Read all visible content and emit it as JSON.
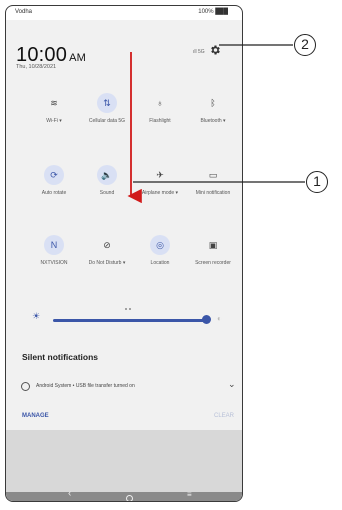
{
  "status_bar": {
    "carrier": "Vodha",
    "battery": "100% ███"
  },
  "header": {
    "time": "10:00",
    "ampm": "AM",
    "date": "Thu, 10/28/2021",
    "signal": "ıll 5G"
  },
  "tiles": [
    {
      "label": "Wi-Fi ▾",
      "icon": "wifi-off-icon",
      "glyph": "≋",
      "active": false
    },
    {
      "label": "Cellular data 5G",
      "icon": "cellular-data-icon",
      "glyph": "⇅",
      "active": true
    },
    {
      "label": "Flashlight",
      "icon": "flashlight-icon",
      "glyph": "♁",
      "active": false
    },
    {
      "label": "Bluetooth ▾",
      "icon": "bluetooth-icon",
      "glyph": "ᛒ",
      "active": false
    },
    {
      "label": "Auto rotate",
      "icon": "auto-rotate-icon",
      "glyph": "⟳",
      "active": true
    },
    {
      "label": "Sound",
      "icon": "sound-icon",
      "glyph": "🔈",
      "active": true
    },
    {
      "label": "Airplane mode ▾",
      "icon": "airplane-icon",
      "glyph": "✈",
      "active": false
    },
    {
      "label": "Mini notification",
      "icon": "mini-notification-icon",
      "glyph": "▭",
      "active": false
    },
    {
      "label": "NXTVISION",
      "icon": "nxtvision-icon",
      "glyph": "N",
      "active": true
    },
    {
      "label": "Do Not Disturb ▾",
      "icon": "do-not-disturb-icon",
      "glyph": "⊘",
      "active": false
    },
    {
      "label": "Location",
      "icon": "location-icon",
      "glyph": "◎",
      "active": true
    },
    {
      "label": "Screen recorder",
      "icon": "screen-recorder-icon",
      "glyph": "▣",
      "active": false
    }
  ],
  "brightness": {
    "level": 0.96,
    "icon": "brightness-icon"
  },
  "notifications": {
    "header": "Silent notifications",
    "item_text": "Android System • USB file transfer turned on",
    "manage": "MANAGE",
    "clear": "CLEAR"
  },
  "callouts": {
    "one": "1",
    "two": "2"
  },
  "colors": {
    "accent": "#3b56a8",
    "active_bg": "#d9e0f4",
    "arrow": "#d11a1a",
    "panel": "#f1f1f1"
  }
}
